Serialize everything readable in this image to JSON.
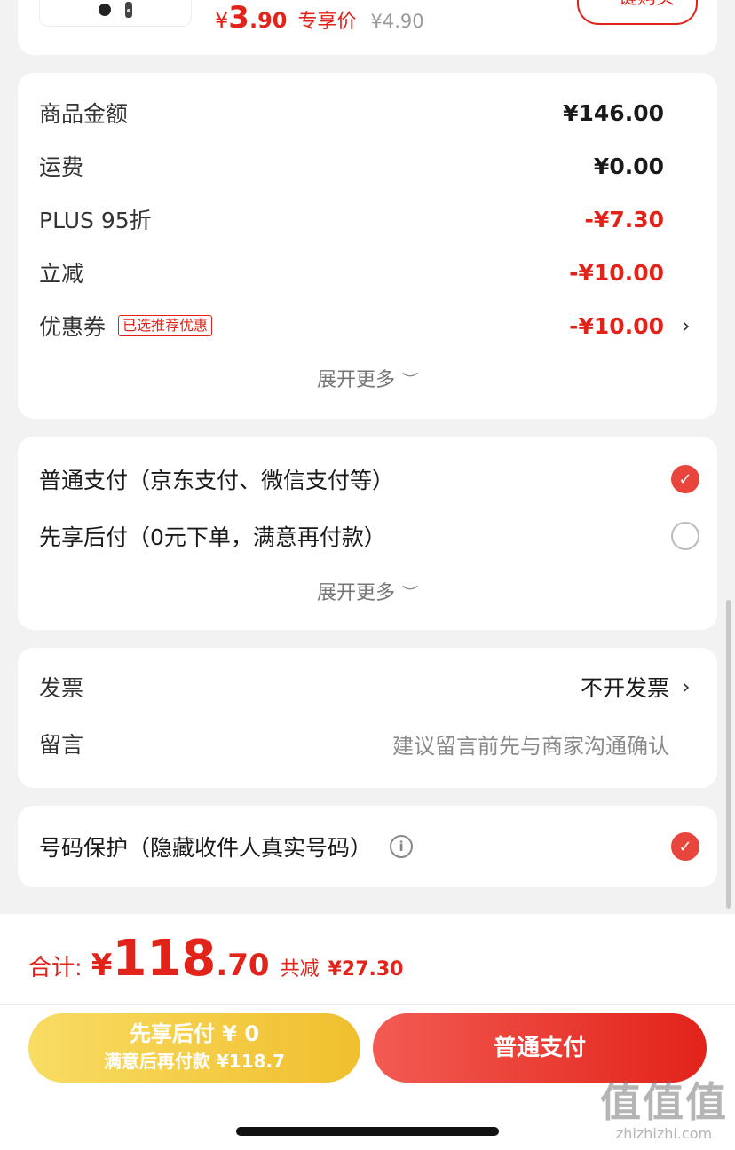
{
  "product": {
    "price_yen": "¥",
    "price_int": "3",
    "price_dec": ".90",
    "price_tag": "专享价",
    "original_price": "¥4.90",
    "buy_button": "一键购买"
  },
  "summary": {
    "rows": [
      {
        "label": "商品金额",
        "value": "¥146.00"
      },
      {
        "label": "运费",
        "value": "¥0.00"
      },
      {
        "label": "PLUS 95折",
        "value": "-¥7.30"
      },
      {
        "label": "立减",
        "value": "-¥10.00"
      },
      {
        "label": "优惠券",
        "value": "-¥10.00",
        "badge": "已选推荐优惠"
      }
    ],
    "expand": "展开更多"
  },
  "payment": {
    "options": [
      {
        "label": "普通支付（京东支付、微信支付等）",
        "selected": true
      },
      {
        "label": "先享后付（0元下单，满意再付款）",
        "selected": false
      }
    ],
    "expand": "展开更多"
  },
  "invoice": {
    "label": "发票",
    "value": "不开发票",
    "message_label": "留言",
    "message_placeholder": "建议留言前先与商家沟通确认"
  },
  "protect": {
    "label": "号码保护（隐藏收件人真实号码）",
    "selected": true
  },
  "bottom": {
    "total_label": "合计:",
    "total_yen": "¥",
    "total_int": "118",
    "total_dec": ".70",
    "save_label": "共减",
    "save_value": "¥27.30",
    "later_line1": "先享后付 ¥ 0",
    "later_line2": "满意后再付款 ¥118.7",
    "pay_button": "普通支付"
  },
  "watermark": {
    "main": "值值值",
    "site": "zhizhizhi.com"
  },
  "colors": {
    "accent": "#e2231a",
    "yellow": "#f0bf2e",
    "background": "#f2f2f2"
  }
}
